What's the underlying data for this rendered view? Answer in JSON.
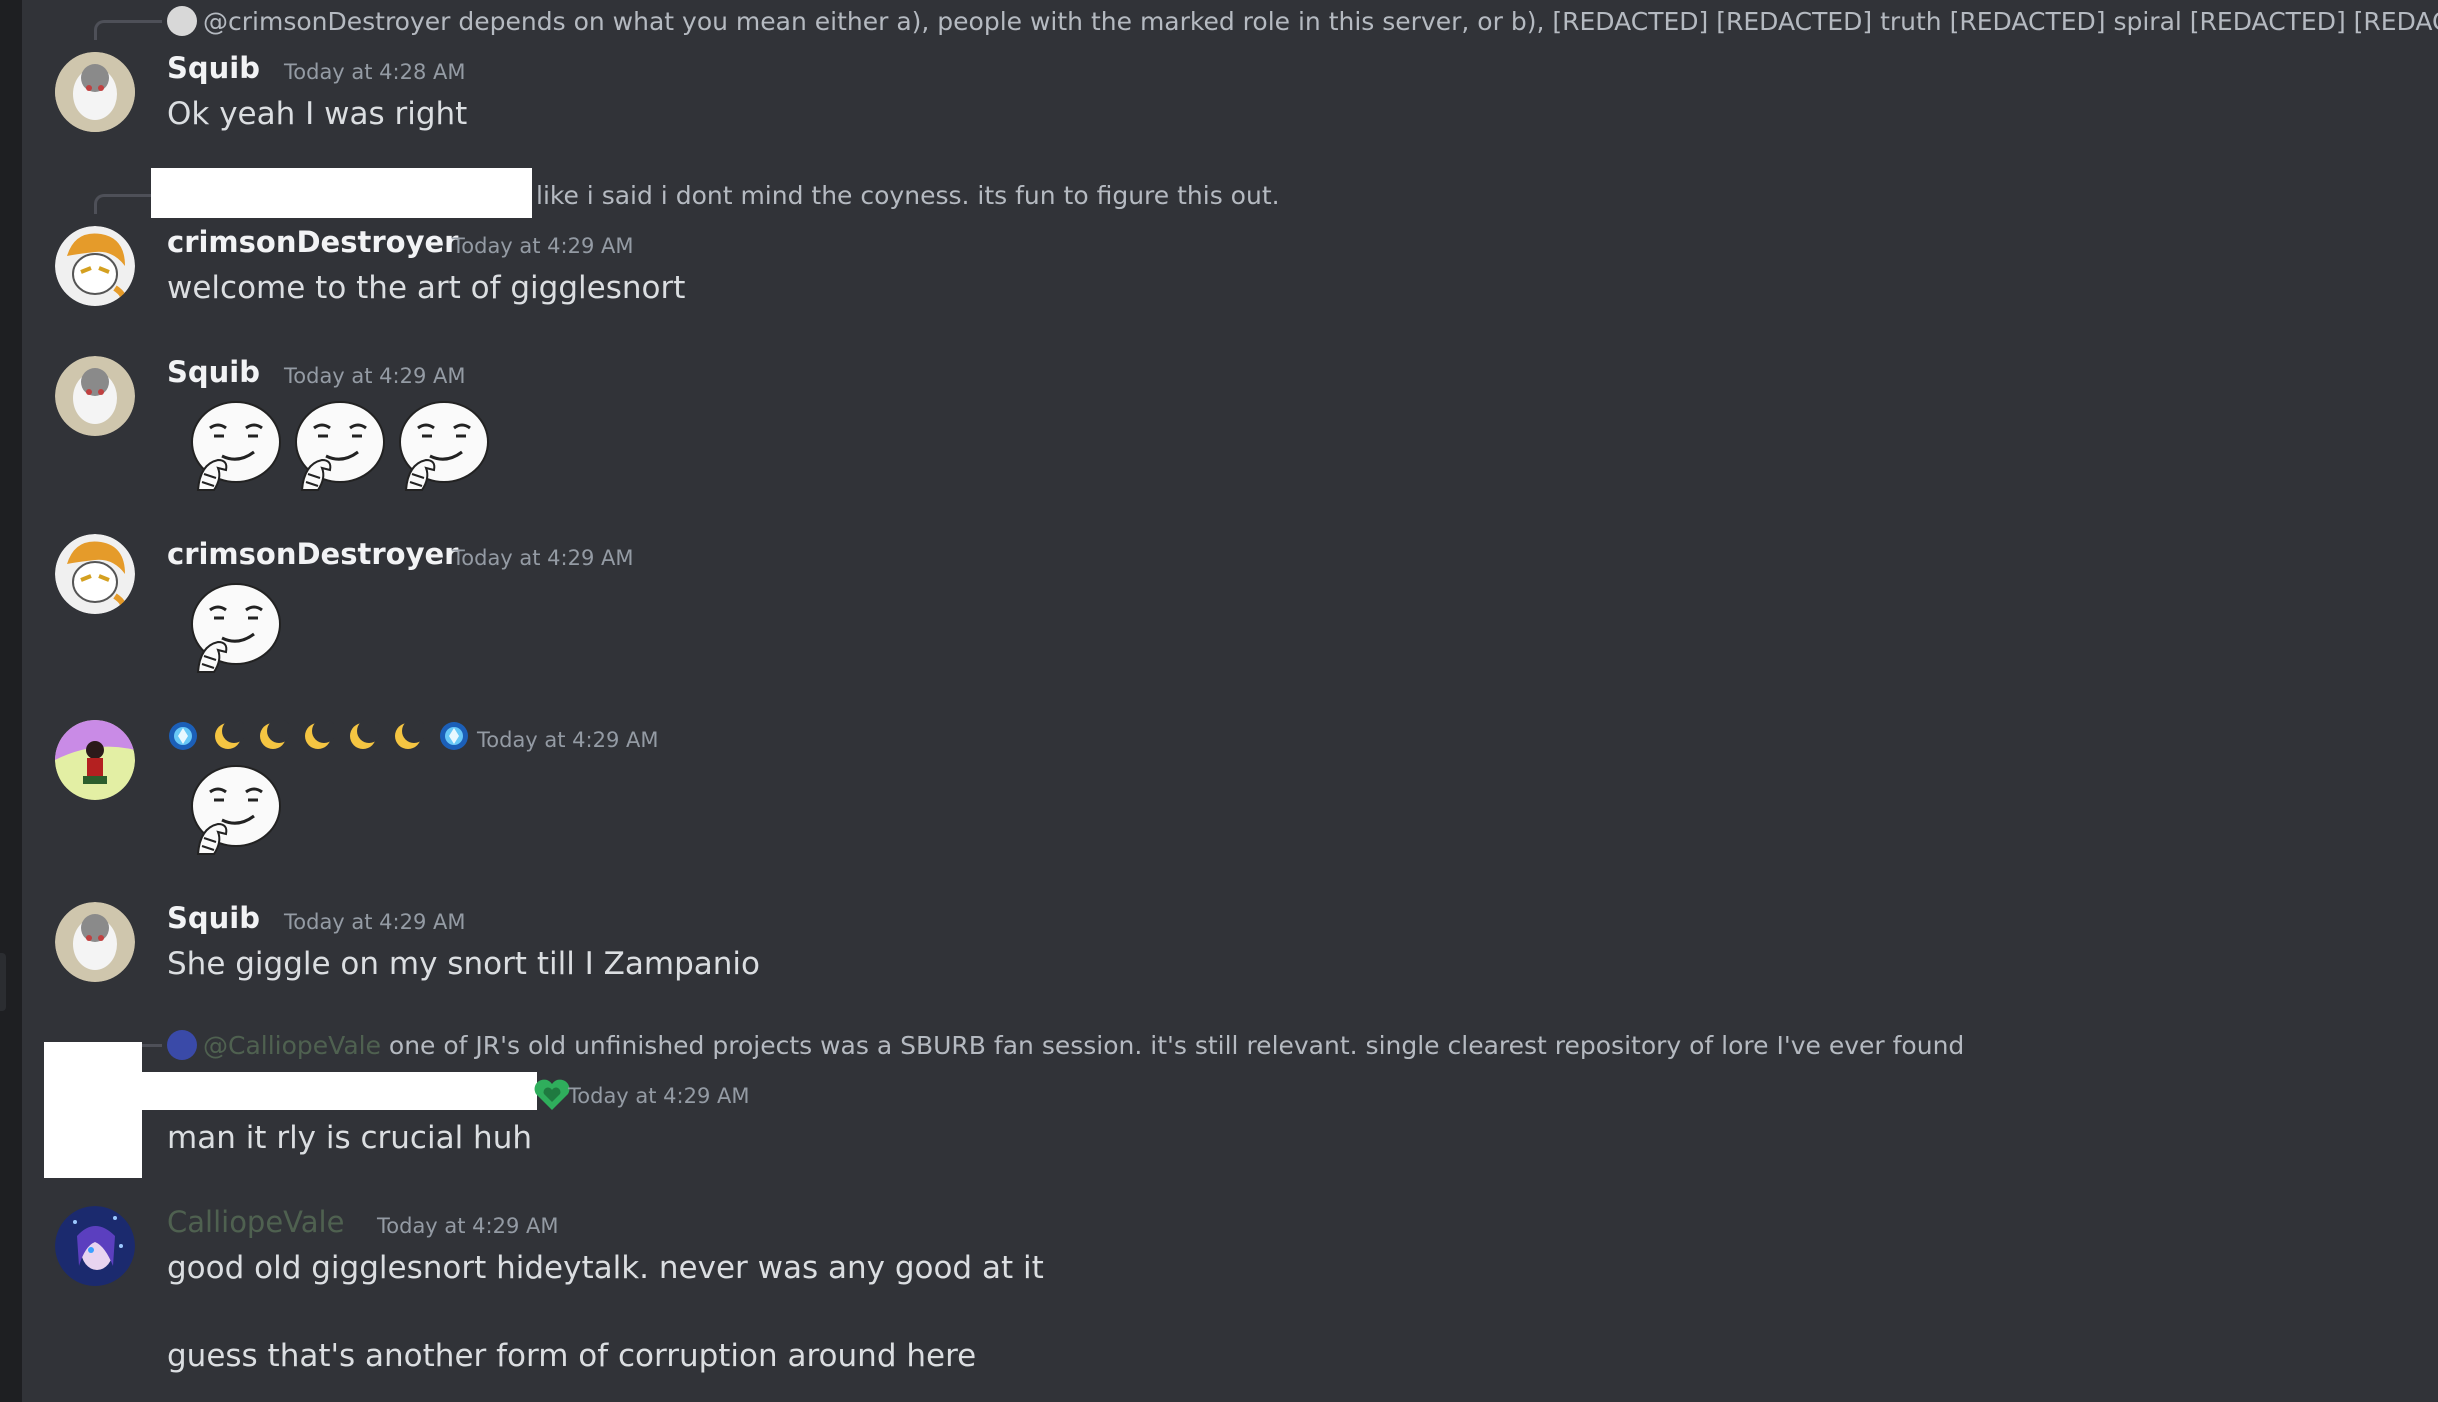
{
  "colors": {
    "background": "#313338",
    "text": "#dbdee1",
    "timestamp": "#949ba4",
    "username_default": "#f2f3f5",
    "username_calliope": "#4f6150",
    "mention": "#b5bac1"
  },
  "messages": {
    "m1": {
      "reply_mention": "@crimsonDestroyer",
      "reply_text": "depends on what you mean either a), people with the marked role in this server, or b), [REDACTED] [REDACTED] truth [REDACTED] spiral [REDACTED] [REDACTED] sto",
      "author": "Squib",
      "time": "Today at 4:28 AM",
      "text": "Ok yeah I was right"
    },
    "m2": {
      "reply_text": "like i said i dont mind the coyness. its fun to figure this out.",
      "author": "crimsonDestroyer",
      "time": "Today at 4:29 AM",
      "text": "welcome to the art of gigglesnort"
    },
    "m3": {
      "author": "Squib",
      "time": "Today at 4:29 AM",
      "emojis": [
        "smirk-emoji",
        "smirk-emoji",
        "smirk-emoji"
      ]
    },
    "m4": {
      "author": "crimsonDestroyer",
      "time": "Today at 4:29 AM",
      "emojis": [
        "smirk-emoji"
      ]
    },
    "m5": {
      "author_emojis": [
        "blue-gem-emoji",
        "crescent-moon-emoji",
        "crescent-moon-emoji",
        "crescent-moon-emoji",
        "crescent-moon-emoji",
        "crescent-moon-emoji",
        "blue-gem-emoji"
      ],
      "time": "Today at 4:29 AM",
      "emojis": [
        "smirk-emoji"
      ]
    },
    "m6": {
      "author": "Squib",
      "time": "Today at 4:29 AM",
      "text": "She giggle on my snort till I Zampanio"
    },
    "m7": {
      "reply_mention": "@CalliopeVale",
      "reply_text": "one of JR's old unfinished projects was a SBURB fan session. it's still relevant. single clearest repository of lore I've ever found",
      "time": "Today at 4:29 AM",
      "text": "man it rly is crucial huh"
    },
    "m8": {
      "author": "CalliopeVale",
      "time": "Today at 4:29 AM",
      "text_line1": "good old gigglesnort hideytalk. never was any good at it",
      "text_line2": "guess that's another form of corruption around here"
    }
  }
}
